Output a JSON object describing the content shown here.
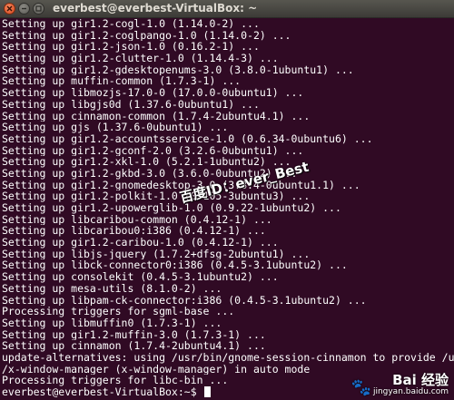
{
  "window": {
    "title": "everbest@everbest-VirtualBox: ~"
  },
  "terminal": {
    "lines": [
      "Setting up gir1.2-cogl-1.0 (1.14.0-2) ...",
      "Setting up gir1.2-coglpango-1.0 (1.14.0-2) ...",
      "Setting up gir1.2-json-1.0 (0.16.2-1) ...",
      "Setting up gir1.2-clutter-1.0 (1.14.4-3) ...",
      "Setting up gir1.2-gdesktopenums-3.0 (3.8.0-1ubuntu1) ...",
      "Setting up muffin-common (1.7.3-1) ...",
      "Setting up libmozjs-17.0-0 (17.0.0-0ubuntu1) ...",
      "Setting up libgjs0d (1.37.6-0ubuntu1) ...",
      "Setting up cinnamon-common (1.7.4-2ubuntu4.1) ...",
      "Setting up gjs (1.37.6-0ubuntu1) ...",
      "Setting up gir1.2-accountsservice-1.0 (0.6.34-0ubuntu6) ...",
      "Setting up gir1.2-gconf-2.0 (3.2.6-0ubuntu1) ...",
      "Setting up gir1.2-xkl-1.0 (5.2.1-1ubuntu2) ...",
      "Setting up gir1.2-gkbd-3.0 (3.6.0-0ubuntu2) ...",
      "Setting up gir1.2-gnomedesktop-3.0 (3.8.4-0ubuntu1.1) ...",
      "Setting up gir1.2-polkit-1.0 (0.105-3ubuntu3) ...",
      "Setting up gir1.2-upowerglib-1.0 (0.9.22-1ubuntu2) ...",
      "Setting up libcaribou-common (0.4.12-1) ...",
      "Setting up libcaribou0:i386 (0.4.12-1) ...",
      "Setting up gir1.2-caribou-1.0 (0.4.12-1) ...",
      "Setting up libjs-jquery (1.7.2+dfsg-2ubuntu1) ...",
      "Setting up libck-connector0:i386 (0.4.5-3.1ubuntu2) ...",
      "Setting up consolekit (0.4.5-3.1ubuntu2) ...",
      "Setting up mesa-utils (8.1.0-2) ...",
      "Setting up libpam-ck-connector:i386 (0.4.5-3.1ubuntu2) ...",
      "Processing triggers for sgml-base ...",
      "Setting up libmuffin0 (1.7.3-1) ...",
      "Setting up gir1.2-muffin-3.0 (1.7.3-1) ...",
      "Setting up cinnamon (1.7.4-2ubuntu4.1) ...",
      "update-alternatives: using /usr/bin/gnome-session-cinnamon to provide /usr/bin",
      "/x-window-manager (x-window-manager) in auto mode",
      "Processing triggers for libc-bin ..."
    ],
    "prompt": "everbest@everbest-VirtualBox:~$ "
  },
  "watermark": {
    "text": "百度ID：ever_Best"
  },
  "logo": {
    "brand_main": "Bai 经验",
    "brand_sub": "jingyan.baidu.com"
  }
}
